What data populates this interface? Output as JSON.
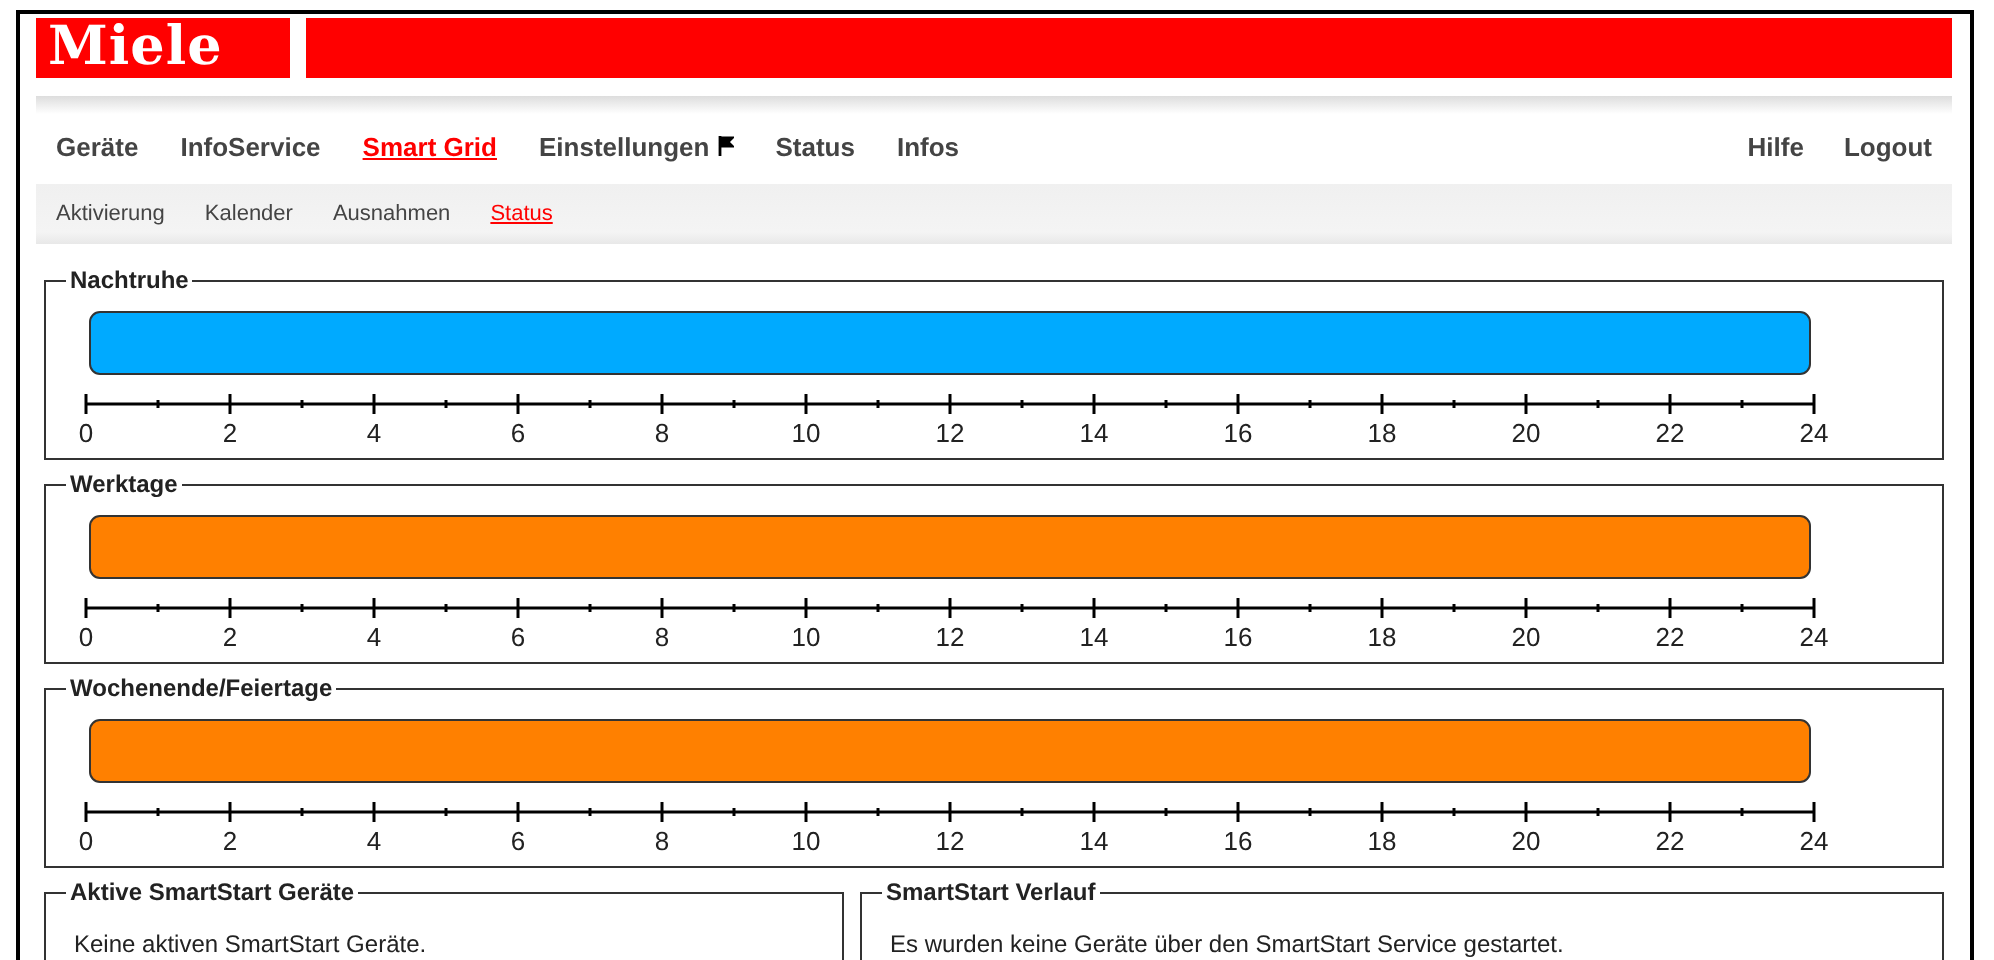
{
  "logo": "Miele",
  "nav": {
    "items": [
      {
        "label": "Geräte",
        "selected": false
      },
      {
        "label": "InfoService",
        "selected": false
      },
      {
        "label": "Smart Grid",
        "selected": true
      },
      {
        "label": "Einstellungen",
        "selected": false,
        "flag": true
      },
      {
        "label": "Status",
        "selected": false
      },
      {
        "label": "Infos",
        "selected": false
      }
    ],
    "right": [
      {
        "label": "Hilfe"
      },
      {
        "label": "Logout"
      }
    ]
  },
  "subnav": [
    {
      "label": "Aktivierung",
      "selected": false
    },
    {
      "label": "Kalender",
      "selected": false
    },
    {
      "label": "Ausnahmen",
      "selected": false
    },
    {
      "label": "Status",
      "selected": true
    }
  ],
  "timelines": [
    {
      "title": "Nachtruhe",
      "color": "#00aaff",
      "ticks": [
        "0",
        "2",
        "4",
        "6",
        "8",
        "10",
        "12",
        "14",
        "16",
        "18",
        "20",
        "22",
        "24"
      ]
    },
    {
      "title": "Werktage",
      "color": "#ff8000",
      "ticks": [
        "0",
        "2",
        "4",
        "6",
        "8",
        "10",
        "12",
        "14",
        "16",
        "18",
        "20",
        "22",
        "24"
      ]
    },
    {
      "title": "Wochenende/Feiertage",
      "color": "#ff8000",
      "ticks": [
        "0",
        "2",
        "4",
        "6",
        "8",
        "10",
        "12",
        "14",
        "16",
        "18",
        "20",
        "22",
        "24"
      ]
    }
  ],
  "panels": [
    {
      "title": "Aktive SmartStart Geräte",
      "text": "Keine aktiven SmartStart Geräte."
    },
    {
      "title": "SmartStart Verlauf",
      "text": "Es wurden keine Geräte über den SmartStart Service gestartet."
    }
  ]
}
